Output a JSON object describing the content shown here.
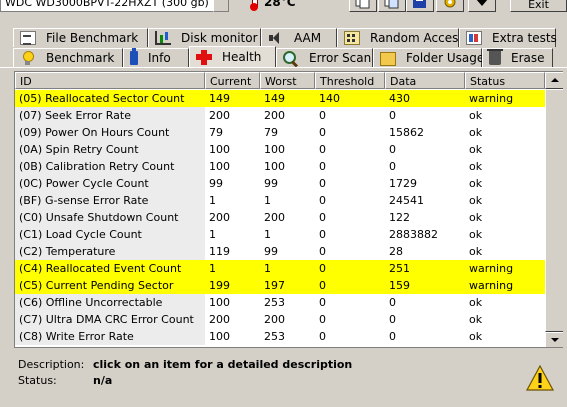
{
  "toolbar": {
    "drive": "WDC WD3000BPVT-22HXZT   (300 gb)",
    "temperature": "28°C",
    "exit_label": "Exit"
  },
  "tabs": {
    "row1": [
      {
        "label": "File Benchmark",
        "icon": "document-icon"
      },
      {
        "label": "Disk monitor",
        "icon": "chart-icon"
      },
      {
        "label": "AAM",
        "icon": "speaker-icon"
      },
      {
        "label": "Random Access",
        "icon": "grid-icon"
      },
      {
        "label": "Extra tests",
        "icon": "extra-tests-icon"
      }
    ],
    "row2": [
      {
        "label": "Benchmark",
        "icon": "bulb-icon"
      },
      {
        "label": "Info",
        "icon": "info-icon"
      },
      {
        "label": "Health",
        "icon": "health-cross-icon",
        "active": true
      },
      {
        "label": "Error Scan",
        "icon": "magnifier-icon"
      },
      {
        "label": "Folder Usage",
        "icon": "folder-icon"
      },
      {
        "label": "Erase",
        "icon": "trash-icon"
      }
    ]
  },
  "table": {
    "headers": [
      "ID",
      "Current",
      "Worst",
      "Threshold",
      "Data",
      "Status"
    ],
    "rows": [
      {
        "id": "(05) Reallocated Sector Count",
        "current": "149",
        "worst": "149",
        "threshold": "140",
        "data": "430",
        "status": "warning"
      },
      {
        "id": "(07) Seek Error Rate",
        "current": "200",
        "worst": "200",
        "threshold": "0",
        "data": "0",
        "status": "ok"
      },
      {
        "id": "(09) Power On Hours Count",
        "current": "79",
        "worst": "79",
        "threshold": "0",
        "data": "15862",
        "status": "ok"
      },
      {
        "id": "(0A) Spin Retry Count",
        "current": "100",
        "worst": "100",
        "threshold": "0",
        "data": "0",
        "status": "ok"
      },
      {
        "id": "(0B) Calibration Retry Count",
        "current": "100",
        "worst": "100",
        "threshold": "0",
        "data": "0",
        "status": "ok"
      },
      {
        "id": "(0C) Power Cycle Count",
        "current": "99",
        "worst": "99",
        "threshold": "0",
        "data": "1729",
        "status": "ok"
      },
      {
        "id": "(BF) G-sense Error Rate",
        "current": "1",
        "worst": "1",
        "threshold": "0",
        "data": "24541",
        "status": "ok"
      },
      {
        "id": "(C0) Unsafe Shutdown Count",
        "current": "200",
        "worst": "200",
        "threshold": "0",
        "data": "122",
        "status": "ok"
      },
      {
        "id": "(C1) Load Cycle Count",
        "current": "1",
        "worst": "1",
        "threshold": "0",
        "data": "2883882",
        "status": "ok"
      },
      {
        "id": "(C2) Temperature",
        "current": "119",
        "worst": "99",
        "threshold": "0",
        "data": "28",
        "status": "ok"
      },
      {
        "id": "(C4) Reallocated Event Count",
        "current": "1",
        "worst": "1",
        "threshold": "0",
        "data": "251",
        "status": "warning"
      },
      {
        "id": "(C5) Current Pending Sector",
        "current": "199",
        "worst": "197",
        "threshold": "0",
        "data": "159",
        "status": "warning"
      },
      {
        "id": "(C6) Offline Uncorrectable",
        "current": "100",
        "worst": "253",
        "threshold": "0",
        "data": "0",
        "status": "ok"
      },
      {
        "id": "(C7) Ultra DMA CRC Error Count",
        "current": "200",
        "worst": "200",
        "threshold": "0",
        "data": "0",
        "status": "ok"
      },
      {
        "id": "(C8) Write Error Rate",
        "current": "100",
        "worst": "253",
        "threshold": "0",
        "data": "0",
        "status": "ok"
      }
    ]
  },
  "details": {
    "description_label": "Description:",
    "description_value": "click on an item for a detailed description",
    "status_label": "Status:",
    "status_value": "n/a"
  },
  "colors": {
    "warning_row": "#ffff00",
    "window_bg": "#d4d0c8"
  }
}
